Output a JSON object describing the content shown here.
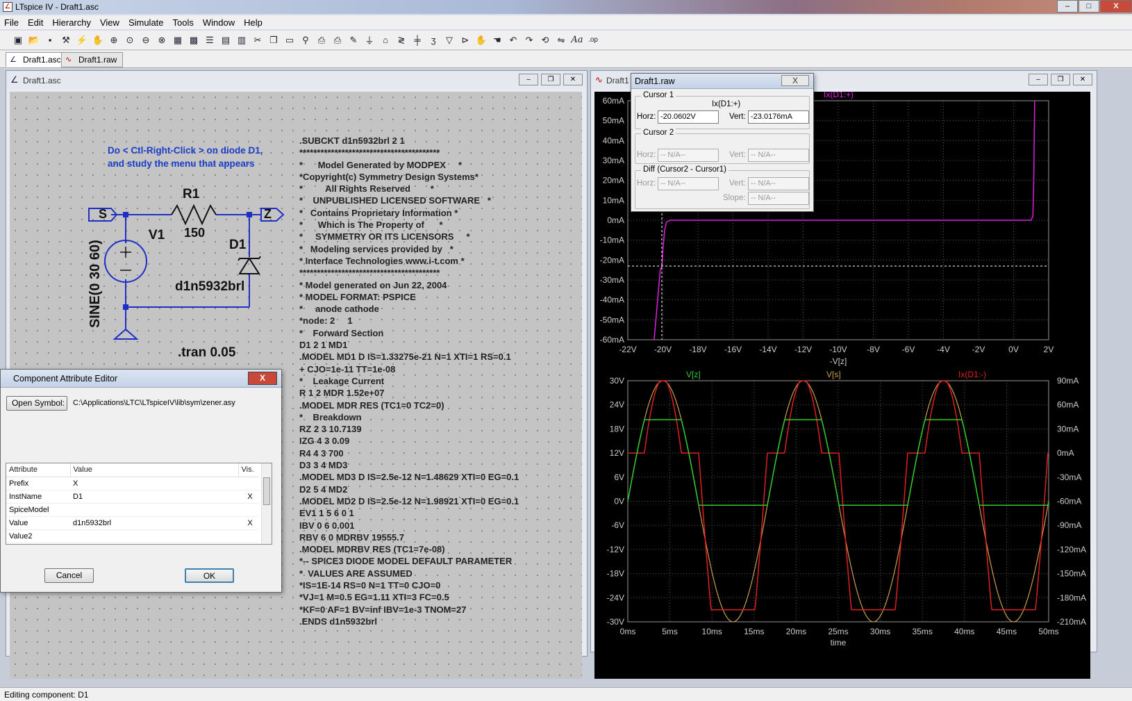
{
  "app": {
    "title": "LTspice IV - Draft1.asc",
    "min": "–",
    "max": "□",
    "close": "X"
  },
  "menu": [
    "File",
    "Edit",
    "Hierarchy",
    "View",
    "Simulate",
    "Tools",
    "Window",
    "Help"
  ],
  "toolbar_icons": [
    "new-schematic",
    "open",
    "save",
    "control-panel",
    "run",
    "halt",
    "zoom-in",
    "pan",
    "zoom-out",
    "zoom-fit",
    "autorange",
    "tile-horizontal",
    "tile-vertical",
    "cascade",
    "cut",
    "copy",
    "paste",
    "find",
    "print-setup",
    "print",
    "draw-wire",
    "ground",
    "label-net",
    "resistor",
    "capacitor",
    "inductor",
    "diode",
    "component",
    "move",
    "drag",
    "undo",
    "redo",
    "rotate",
    "mirror",
    "text",
    "spice-directive"
  ],
  "tabs": [
    {
      "label": "Draft1.asc"
    },
    {
      "label": "Draft1.raw"
    }
  ],
  "schematic": {
    "title": "Draft1.asc",
    "note": [
      "Do < Ctl-Right-Click > on diode D1,",
      "and study the menu that appears"
    ],
    "labels": {
      "s": "S",
      "z": "Z",
      "r1": "R1",
      "r1_value": "150",
      "v1": "V1",
      "d1": "D1",
      "d1_value": "d1n5932brl",
      "source": "SINE(0 30 60)",
      "tran": ".tran 0.05"
    },
    "netlist": [
      ".SUBCKT d1n5932brl 2 1",
      "****************************************",
      "*      Model Generated by MODPEX     *",
      "*Copyright(c) Symmetry Design Systems*",
      "*         All Rights Reserved        *",
      "*    UNPUBLISHED LICENSED SOFTWARE   *",
      "*   Contains Proprietary Information *",
      "*      Which is The Property of      *",
      "*     SYMMETRY OR ITS LICENSORS     *",
      "*   Modeling services provided by   *",
      "* Interface Technologies www.i-t.com *",
      "****************************************",
      "* Model generated on Jun 22, 2004",
      "* MODEL FORMAT: PSPICE",
      "*     anode cathode",
      "*node: 2     1",
      "*    Forward Section",
      "D1 2 1 MD1",
      ".MODEL MD1 D IS=1.33275e-21 N=1 XTI=1 RS=0.1",
      "+ CJO=1e-11 TT=1e-08",
      "*    Leakage Current",
      "R 1 2 MDR 1.52e+07",
      ".MODEL MDR RES (TC1=0 TC2=0)",
      "*    Breakdown",
      "RZ 2 3 10.7139",
      "IZG 4 3 0.09",
      "R4 4 3 700",
      "D3 3 4 MD3",
      ".MODEL MD3 D IS=2.5e-12 N=1.48629 XTI=0 EG=0.1",
      "D2 5 4 MD2",
      ".MODEL MD2 D IS=2.5e-12 N=1.98921 XTI=0 EG=0.1",
      "EV1 1 5 6 0 1",
      "IBV 0 6 0.001",
      "RBV 6 0 MDRBV 19555.7",
      ".MODEL MDRBV RES (TC1=7e-08)",
      "*-- SPICE3 DIODE MODEL DEFAULT PARAMETER",
      "*  VALUES ARE ASSUMED",
      "*IS=1E-14 RS=0 N=1 TT=0 CJO=0",
      "*VJ=1 M=0.5 EG=1.11 XTI=3 FC=0.5",
      "*KF=0 AF=1 BV=inf IBV=1e-3 TNOM=27",
      ".ENDS d1n5932brl"
    ]
  },
  "waveform": {
    "title": "Draft1.raw",
    "tab_stub": "Draft1"
  },
  "cursor_dialog": {
    "title": "Draft1.raw",
    "close": "X",
    "cursor1": {
      "label": "Cursor 1",
      "trace": "Ix(D1:+)",
      "horz_label": "Horz:",
      "horz": "-20.0602V",
      "vert_label": "Vert:",
      "vert": "-23.0176mA"
    },
    "cursor2": {
      "label": "Cursor 2",
      "horz_label": "Horz:",
      "horz": "-- N/A--",
      "vert_label": "Vert:",
      "vert": "-- N/A--"
    },
    "diff": {
      "label": "Diff (Cursor2 - Cursor1)",
      "horz_label": "Horz:",
      "horz": "-- N/A--",
      "vert_label": "Vert:",
      "vert": "-- N/A--",
      "slope_label": "Slope:",
      "slope": "-- N/A--"
    }
  },
  "attr_editor": {
    "title": "Component Attribute Editor",
    "close": "X",
    "open_symbol": "Open Symbol:",
    "path": "C:\\Applications\\LTC\\LTspiceIV\\lib\\sym\\zener.asy",
    "headers": [
      "Attribute",
      "Value",
      "Vis."
    ],
    "rows": [
      {
        "attr": "Prefix",
        "value": "X",
        "vis": ""
      },
      {
        "attr": "InstName",
        "value": "D1",
        "vis": "X"
      },
      {
        "attr": "SpiceModel",
        "value": "",
        "vis": ""
      },
      {
        "attr": "Value",
        "value": "d1n5932brl",
        "vis": "X"
      },
      {
        "attr": "Value2",
        "value": "",
        "vis": ""
      }
    ],
    "cancel": "Cancel",
    "ok": "OK"
  },
  "status": "Editing component: D1",
  "chart_data": [
    {
      "type": "line",
      "title": "",
      "series": [
        {
          "name": "Ix(D1:+)",
          "color": "#e020e0",
          "x": [
            -20.5,
            -20.3,
            -20.15,
            -20.06,
            -20.0,
            -19.9,
            -19.8,
            -19.6,
            -19.2,
            -18,
            -10,
            0,
            0.8,
            1.0,
            1.1,
            1.15,
            1.2
          ],
          "y": [
            -60,
            -40,
            -25,
            -23,
            -15,
            -5,
            -1,
            0,
            0,
            0,
            0,
            0,
            0,
            0,
            2,
            20,
            60
          ]
        }
      ],
      "xlabel": "-V[z]",
      "xlim": [
        -22,
        2
      ],
      "xticks": [
        "-22V",
        "-20V",
        "-18V",
        "-16V",
        "-14V",
        "-12V",
        "-10V",
        "-8V",
        "-6V",
        "-4V",
        "-2V",
        "0V",
        "2V"
      ],
      "ylim": [
        -60,
        60
      ],
      "yticks": [
        "60mA",
        "50mA",
        "40mA",
        "30mA",
        "20mA",
        "10mA",
        "0mA",
        "-10mA",
        "-20mA",
        "-30mA",
        "-40mA",
        "-50mA",
        "-60mA"
      ],
      "cursor": {
        "x": -20.0602,
        "y": -23.0176
      },
      "grid": true
    },
    {
      "type": "line",
      "series": [
        {
          "name": "V[z]",
          "color": "#2fcc2f",
          "description": "clipped near 20.3V on positive half, about -1V on negative half"
        },
        {
          "name": "V[s]",
          "color": "#c8a050",
          "amplitude": 30,
          "frequency_hz": 60
        },
        {
          "name": "Ix(D1:-)",
          "color": "#e02020",
          "axis": "right",
          "peak": "90mA",
          "trough": "-180mA"
        }
      ],
      "xlabel": "time",
      "xlim": [
        0,
        50
      ],
      "xticks": [
        "0ms",
        "5ms",
        "10ms",
        "15ms",
        "20ms",
        "25ms",
        "30ms",
        "35ms",
        "40ms",
        "45ms",
        "50ms"
      ],
      "ylim": [
        -30,
        30
      ],
      "yticks": [
        "30V",
        "24V",
        "18V",
        "12V",
        "6V",
        "0V",
        "-6V",
        "-12V",
        "-18V",
        "-24V",
        "-30V"
      ],
      "y2ticks": [
        "90mA",
        "60mA",
        "30mA",
        "0mA",
        "-30mA",
        "-60mA",
        "-90mA",
        "-120mA",
        "-150mA",
        "-180mA",
        "-210mA"
      ],
      "grid": true
    }
  ]
}
